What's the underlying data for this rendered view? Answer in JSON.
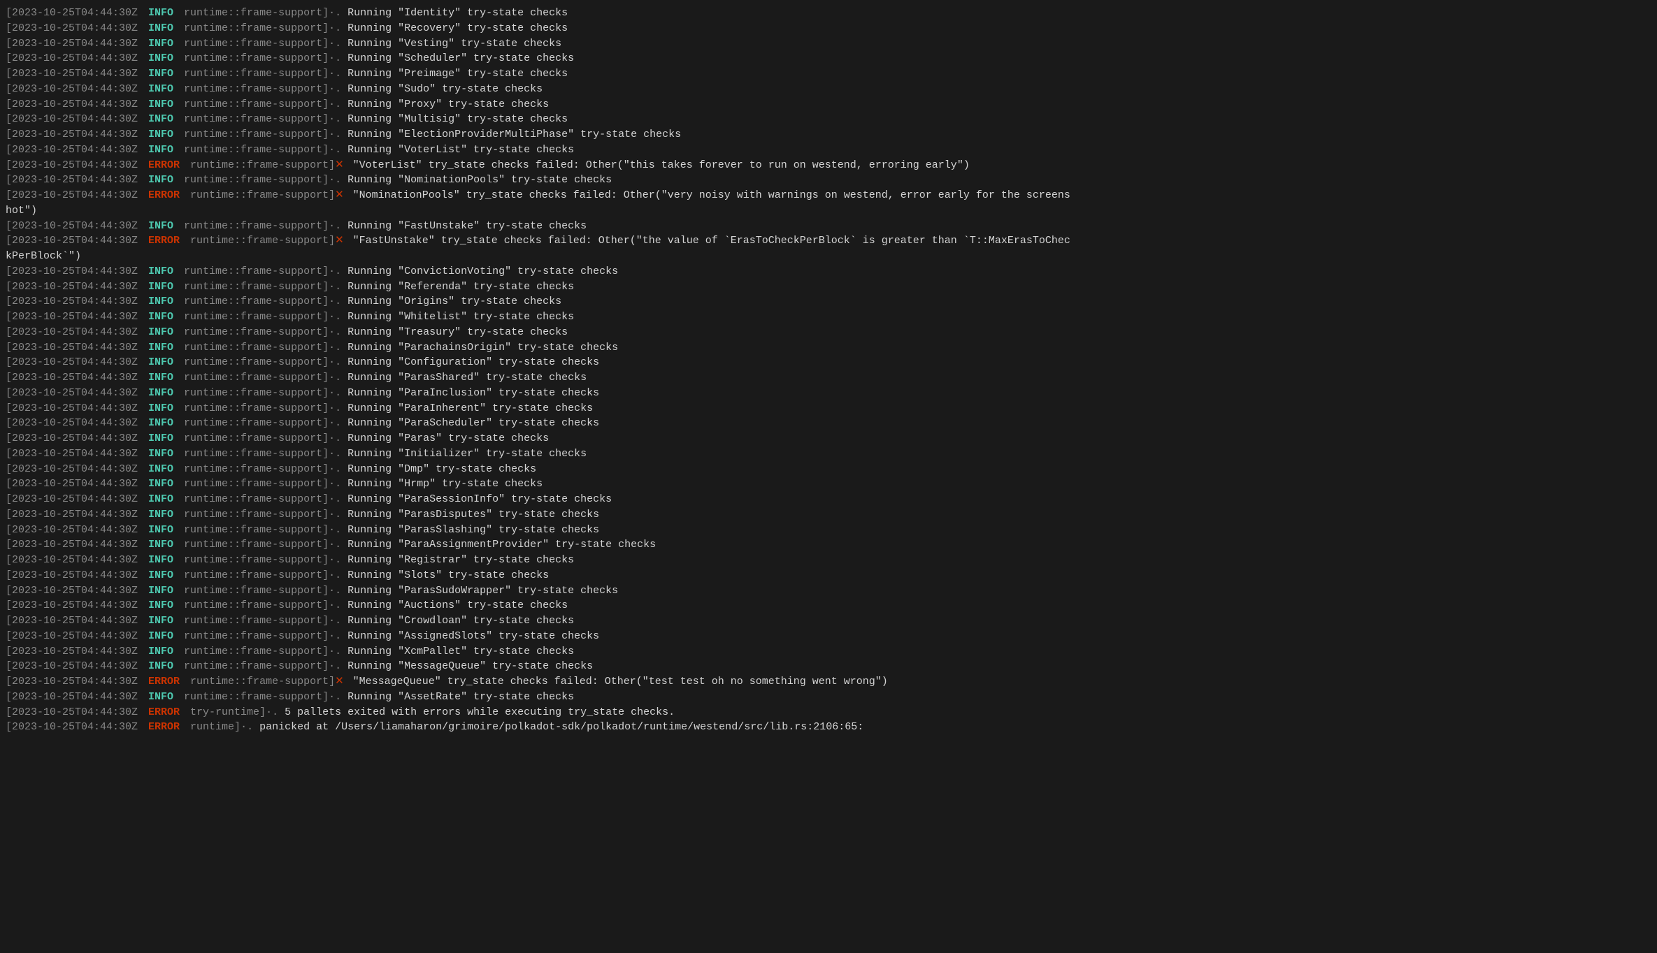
{
  "terminal": {
    "background": "#1a1a1a",
    "lines": [
      {
        "ts": "[2023-10-25T04:44:30Z",
        "level": "INFO",
        "source": "runtime::frame-support]",
        "msg": "Running \"Identity\" try-state checks",
        "error": false
      },
      {
        "ts": "[2023-10-25T04:44:30Z",
        "level": "INFO",
        "source": "runtime::frame-support]",
        "msg": "Running \"Recovery\" try-state checks",
        "error": false
      },
      {
        "ts": "[2023-10-25T04:44:30Z",
        "level": "INFO",
        "source": "runtime::frame-support]",
        "msg": "Running \"Vesting\" try-state checks",
        "error": false
      },
      {
        "ts": "[2023-10-25T04:44:30Z",
        "level": "INFO",
        "source": "runtime::frame-support]",
        "msg": "Running \"Scheduler\" try-state checks",
        "error": false
      },
      {
        "ts": "[2023-10-25T04:44:30Z",
        "level": "INFO",
        "source": "runtime::frame-support]",
        "msg": "Running \"Preimage\" try-state checks",
        "error": false
      },
      {
        "ts": "[2023-10-25T04:44:30Z",
        "level": "INFO",
        "source": "runtime::frame-support]",
        "msg": "Running \"Sudo\" try-state checks",
        "error": false
      },
      {
        "ts": "[2023-10-25T04:44:30Z",
        "level": "INFO",
        "source": "runtime::frame-support]",
        "msg": "Running \"Proxy\" try-state checks",
        "error": false
      },
      {
        "ts": "[2023-10-25T04:44:30Z",
        "level": "INFO",
        "source": "runtime::frame-support]",
        "msg": "Running \"Multisig\" try-state checks",
        "error": false
      },
      {
        "ts": "[2023-10-25T04:44:30Z",
        "level": "INFO",
        "source": "runtime::frame-support]",
        "msg": "Running \"ElectionProviderMultiPhase\" try-state checks",
        "error": false
      },
      {
        "ts": "[2023-10-25T04:44:30Z",
        "level": "INFO",
        "source": "runtime::frame-support]",
        "msg": "Running \"VoterList\" try-state checks",
        "error": false
      },
      {
        "ts": "[2023-10-25T04:44:30Z",
        "level": "ERROR",
        "source": "runtime::frame-support]",
        "msg": "\"VoterList\" try_state checks failed: Other(\"this takes forever to run on westend, erroring early\")",
        "error": true
      },
      {
        "ts": "[2023-10-25T04:44:30Z",
        "level": "INFO",
        "source": "runtime::frame-support]",
        "msg": "Running \"NominationPools\" try-state checks",
        "error": false
      },
      {
        "ts": "[2023-10-25T04:44:30Z",
        "level": "ERROR",
        "source": "runtime::frame-support]",
        "msg": "\"NominationPools\" try_state checks failed: Other(\"very noisy with warnings on westend, error early for the screens hot\")",
        "error": true,
        "wrap": true
      },
      {
        "ts": "[2023-10-25T04:44:30Z",
        "level": "INFO",
        "source": "runtime::frame-support]",
        "msg": "Running \"FastUnstake\" try-state checks",
        "error": false
      },
      {
        "ts": "[2023-10-25T04:44:30Z",
        "level": "ERROR",
        "source": "runtime::frame-support]",
        "msg": "\"FastUnstake\" try_state checks failed: Other(\"the value of `ErasToCheckPerBlock` is greater than `T::MaxErasToCheckPerBlock`\")",
        "error": true,
        "wrap": true
      },
      {
        "ts": "[2023-10-25T04:44:30Z",
        "level": "INFO",
        "source": "runtime::frame-support]",
        "msg": "Running \"ConvictionVoting\" try-state checks",
        "error": false
      },
      {
        "ts": "[2023-10-25T04:44:30Z",
        "level": "INFO",
        "source": "runtime::frame-support]",
        "msg": "Running \"Referenda\" try-state checks",
        "error": false
      },
      {
        "ts": "[2023-10-25T04:44:30Z",
        "level": "INFO",
        "source": "runtime::frame-support]",
        "msg": "Running \"Origins\" try-state checks",
        "error": false
      },
      {
        "ts": "[2023-10-25T04:44:30Z",
        "level": "INFO",
        "source": "runtime::frame-support]",
        "msg": "Running \"Whitelist\" try-state checks",
        "error": false
      },
      {
        "ts": "[2023-10-25T04:44:30Z",
        "level": "INFO",
        "source": "runtime::frame-support]",
        "msg": "Running \"Treasury\" try-state checks",
        "error": false
      },
      {
        "ts": "[2023-10-25T04:44:30Z",
        "level": "INFO",
        "source": "runtime::frame-support]",
        "msg": "Running \"ParachainsOrigin\" try-state checks",
        "error": false
      },
      {
        "ts": "[2023-10-25T04:44:30Z",
        "level": "INFO",
        "source": "runtime::frame-support]",
        "msg": "Running \"Configuration\" try-state checks",
        "error": false
      },
      {
        "ts": "[2023-10-25T04:44:30Z",
        "level": "INFO",
        "source": "runtime::frame-support]",
        "msg": "Running \"ParasShared\" try-state checks",
        "error": false
      },
      {
        "ts": "[2023-10-25T04:44:30Z",
        "level": "INFO",
        "source": "runtime::frame-support]",
        "msg": "Running \"ParaInclusion\" try-state checks",
        "error": false
      },
      {
        "ts": "[2023-10-25T04:44:30Z",
        "level": "INFO",
        "source": "runtime::frame-support]",
        "msg": "Running \"ParaInherent\" try-state checks",
        "error": false
      },
      {
        "ts": "[2023-10-25T04:44:30Z",
        "level": "INFO",
        "source": "runtime::frame-support]",
        "msg": "Running \"ParaScheduler\" try-state checks",
        "error": false
      },
      {
        "ts": "[2023-10-25T04:44:30Z",
        "level": "INFO",
        "source": "runtime::frame-support]",
        "msg": "Running \"Paras\" try-state checks",
        "error": false
      },
      {
        "ts": "[2023-10-25T04:44:30Z",
        "level": "INFO",
        "source": "runtime::frame-support]",
        "msg": "Running \"Initializer\" try-state checks",
        "error": false
      },
      {
        "ts": "[2023-10-25T04:44:30Z",
        "level": "INFO",
        "source": "runtime::frame-support]",
        "msg": "Running \"Dmp\" try-state checks",
        "error": false
      },
      {
        "ts": "[2023-10-25T04:44:30Z",
        "level": "INFO",
        "source": "runtime::frame-support]",
        "msg": "Running \"Hrmp\" try-state checks",
        "error": false
      },
      {
        "ts": "[2023-10-25T04:44:30Z",
        "level": "INFO",
        "source": "runtime::frame-support]",
        "msg": "Running \"ParaSessionInfo\" try-state checks",
        "error": false
      },
      {
        "ts": "[2023-10-25T04:44:30Z",
        "level": "INFO",
        "source": "runtime::frame-support]",
        "msg": "Running \"ParasDisputes\" try-state checks",
        "error": false
      },
      {
        "ts": "[2023-10-25T04:44:30Z",
        "level": "INFO",
        "source": "runtime::frame-support]",
        "msg": "Running \"ParasSlashing\" try-state checks",
        "error": false
      },
      {
        "ts": "[2023-10-25T04:44:30Z",
        "level": "INFO",
        "source": "runtime::frame-support]",
        "msg": "Running \"ParaAssignmentProvider\" try-state checks",
        "error": false
      },
      {
        "ts": "[2023-10-25T04:44:30Z",
        "level": "INFO",
        "source": "runtime::frame-support]",
        "msg": "Running \"Registrar\" try-state checks",
        "error": false
      },
      {
        "ts": "[2023-10-25T04:44:30Z",
        "level": "INFO",
        "source": "runtime::frame-support]",
        "msg": "Running \"Slots\" try-state checks",
        "error": false
      },
      {
        "ts": "[2023-10-25T04:44:30Z",
        "level": "INFO",
        "source": "runtime::frame-support]",
        "msg": "Running \"ParasSudoWrapper\" try-state checks",
        "error": false
      },
      {
        "ts": "[2023-10-25T04:44:30Z",
        "level": "INFO",
        "source": "runtime::frame-support]",
        "msg": "Running \"Auctions\" try-state checks",
        "error": false
      },
      {
        "ts": "[2023-10-25T04:44:30Z",
        "level": "INFO",
        "source": "runtime::frame-support]",
        "msg": "Running \"Crowdloan\" try-state checks",
        "error": false
      },
      {
        "ts": "[2023-10-25T04:44:30Z",
        "level": "INFO",
        "source": "runtime::frame-support]",
        "msg": "Running \"AssignedSlots\" try-state checks",
        "error": false
      },
      {
        "ts": "[2023-10-25T04:44:30Z",
        "level": "INFO",
        "source": "runtime::frame-support]",
        "msg": "Running \"XcmPallet\" try-state checks",
        "error": false
      },
      {
        "ts": "[2023-10-25T04:44:30Z",
        "level": "INFO",
        "source": "runtime::frame-support]",
        "msg": "Running \"MessageQueue\" try-state checks",
        "error": false
      },
      {
        "ts": "[2023-10-25T04:44:30Z",
        "level": "ERROR",
        "source": "runtime::frame-support]",
        "msg": "\"MessageQueue\" try_state checks failed: Other(\"test test oh no something went wrong\")",
        "error": true
      },
      {
        "ts": "[2023-10-25T04:44:30Z",
        "level": "INFO",
        "source": "runtime::frame-support]",
        "msg": "Running \"AssetRate\" try-state checks",
        "error": false
      },
      {
        "ts": "[2023-10-25T04:44:30Z",
        "level": "ERROR",
        "source": "try-runtime]",
        "msg": "5 pallets exited with errors while executing try_state checks.",
        "error": false
      },
      {
        "ts": "[2023-10-25T04:44:30Z",
        "level": "ERROR",
        "source": "runtime]",
        "msg": "panicked at /Users/liamaharon/grimoire/polkadot-sdk/polkadot/runtime/westend/src/lib.rs:2106:65:",
        "error": false
      }
    ]
  }
}
